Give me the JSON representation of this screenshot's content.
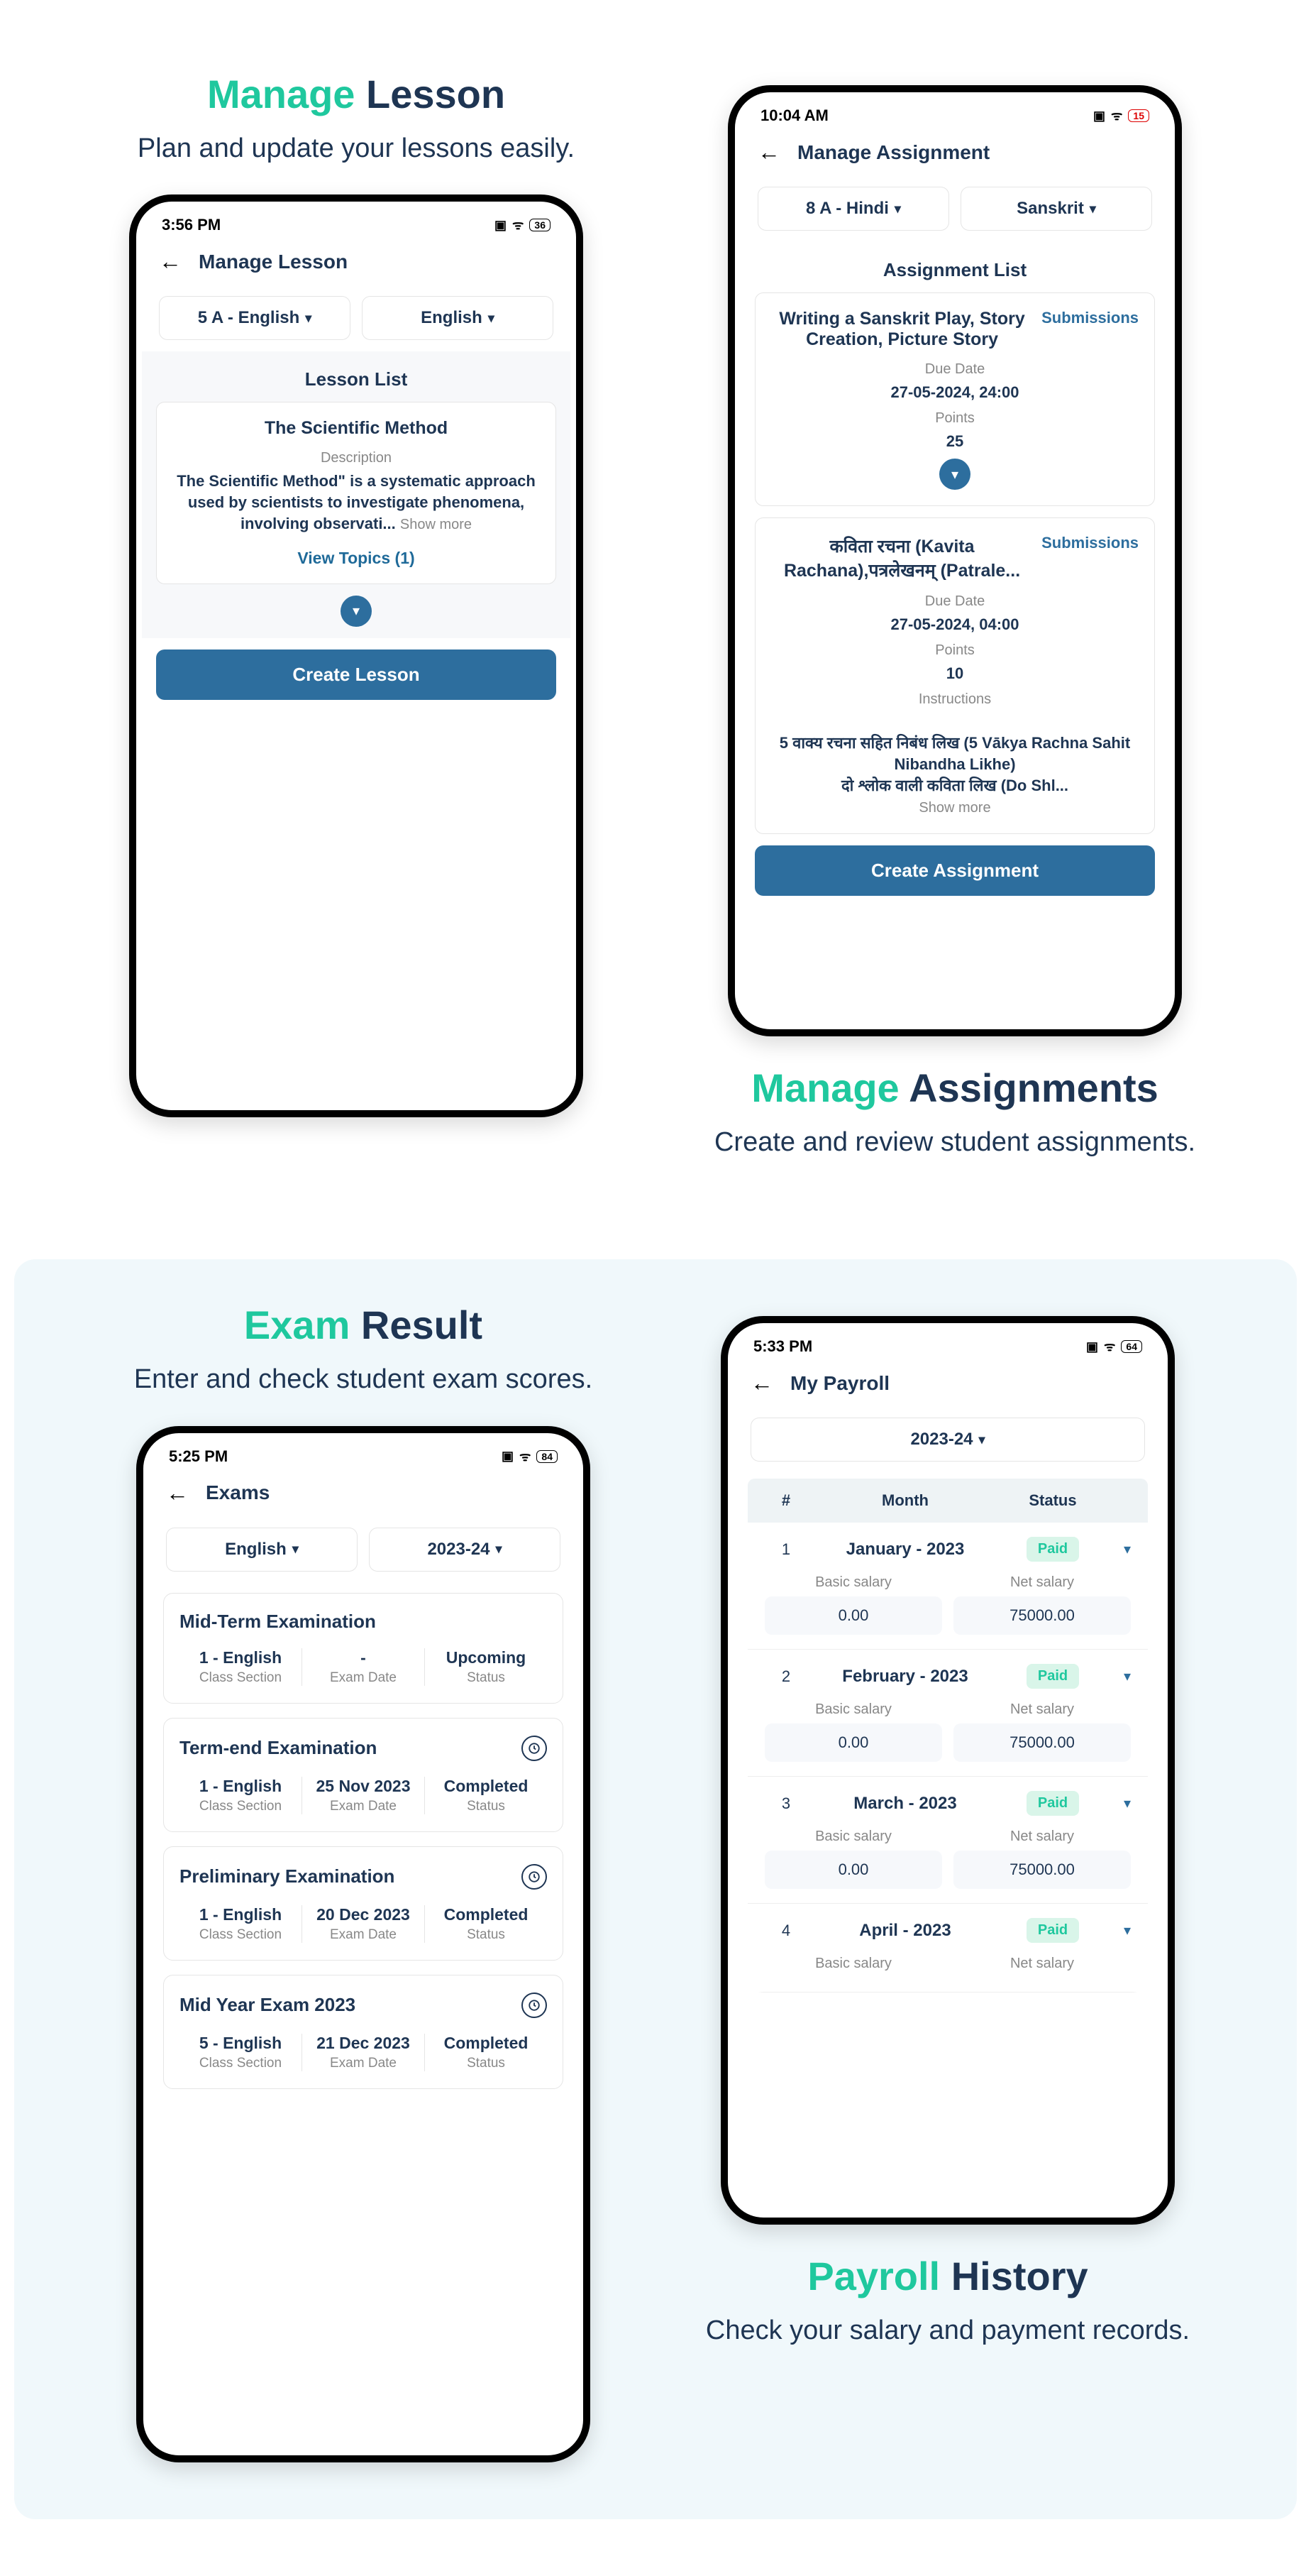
{
  "sections": {
    "lesson": {
      "title_accent": "Manage",
      "title_dark": "Lesson",
      "subtitle": "Plan and update your lessons easily.",
      "phone": {
        "time": "3:56 PM",
        "battery": "36",
        "header": "Manage Lesson",
        "filter_class": "5 A - English",
        "filter_subject": "English",
        "list_label": "Lesson List",
        "item_title": "The Scientific Method",
        "desc_label": "Description",
        "desc_text": "The Scientific Method\" is a systematic approach used by scientists to investigate phenomena, involving observati...",
        "show_more": "Show more",
        "view_topics": "View Topics (1)",
        "create_btn": "Create Lesson"
      }
    },
    "assignment": {
      "title_accent": "Manage",
      "title_dark": "Assignments",
      "subtitle": "Create and review student assignments.",
      "phone": {
        "time": "10:04 AM",
        "header": "Manage Assignment",
        "filter_class": "8 A - Hindi",
        "filter_subject": "Sanskrit",
        "list_label": "Assignment List",
        "submissions": "Submissions",
        "item1_title": "Writing a Sanskrit Play, Story Creation, Picture Story",
        "due_label": "Due Date",
        "item1_due": "27-05-2024, 24:00",
        "points_label": "Points",
        "item1_points": "25",
        "item2_title": "कविता रचना (Kavita Rachana),पत्रलेखनम् (Patrale...",
        "item2_due": "27-05-2024, 04:00",
        "item2_points": "10",
        "instructions_label": "Instructions",
        "item2_instructions": "5 वाक्य रचना सहित निबंध लिख (5 Vākya Rachna Sahit Nibandha Likhe)\nदो श्लोक वाली कविता लिख (Do Shl...",
        "show_more": "Show more",
        "create_btn": "Create Assignment"
      }
    },
    "exam": {
      "title_accent": "Exam",
      "title_dark": "Result",
      "subtitle": "Enter and check student exam scores.",
      "phone": {
        "time": "5:25 PM",
        "battery": "84",
        "header": "Exams",
        "filter_lang": "English",
        "filter_year": "2023-24",
        "class_label": "Class Section",
        "date_label": "Exam Date",
        "status_label": "Status",
        "exams": [
          {
            "name": "Mid-Term Examination",
            "class": "1 - English",
            "date": "-",
            "status": "Upcoming",
            "clock": false
          },
          {
            "name": "Term-end Examination",
            "class": "1 - English",
            "date": "25 Nov 2023",
            "status": "Completed",
            "clock": true
          },
          {
            "name": "Preliminary Examination",
            "class": "1 - English",
            "date": "20 Dec 2023",
            "status": "Completed",
            "clock": true
          },
          {
            "name": "Mid Year Exam 2023",
            "class": "5 - English",
            "date": "21 Dec 2023",
            "status": "Completed",
            "clock": true
          }
        ]
      }
    },
    "payroll": {
      "title_accent": "Payroll",
      "title_dark": "History",
      "subtitle": "Check your salary and payment records.",
      "phone": {
        "time": "5:33 PM",
        "battery": "64",
        "header": "My Payroll",
        "filter_year": "2023-24",
        "col_idx": "#",
        "col_month": "Month",
        "col_status": "Status",
        "basic_label": "Basic salary",
        "net_label": "Net salary",
        "rows": [
          {
            "idx": "1",
            "month": "January - 2023",
            "status": "Paid",
            "basic": "0.00",
            "net": "75000.00"
          },
          {
            "idx": "2",
            "month": "February - 2023",
            "status": "Paid",
            "basic": "0.00",
            "net": "75000.00"
          },
          {
            "idx": "3",
            "month": "March - 2023",
            "status": "Paid",
            "basic": "0.00",
            "net": "75000.00"
          },
          {
            "idx": "4",
            "month": "April - 2023",
            "status": "Paid",
            "basic": "",
            "net": ""
          }
        ]
      }
    }
  }
}
